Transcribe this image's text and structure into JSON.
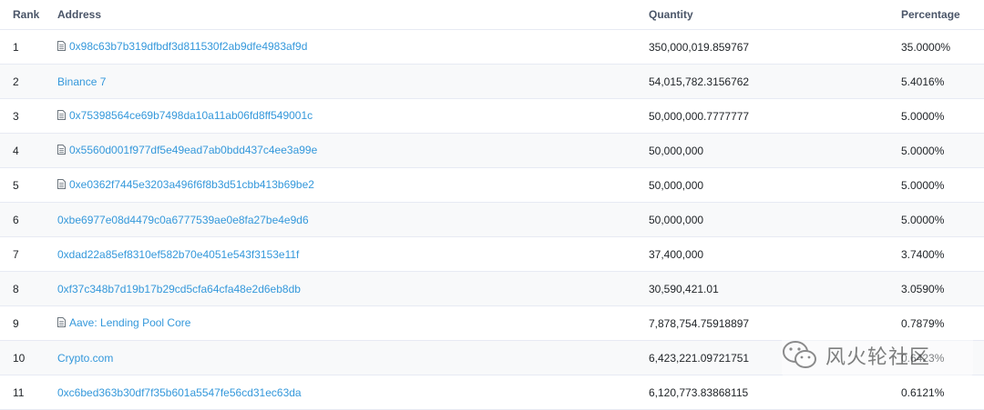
{
  "headers": {
    "rank": "Rank",
    "address": "Address",
    "quantity": "Quantity",
    "percentage": "Percentage"
  },
  "rows": [
    {
      "rank": "1",
      "address": "0x98c63b7b319dfbdf3d811530f2ab9dfe4983af9d",
      "contract": true,
      "quantity": "350,000,019.859767",
      "percentage": "35.0000%"
    },
    {
      "rank": "2",
      "address": "Binance 7",
      "contract": false,
      "quantity": "54,015,782.3156762",
      "percentage": "5.4016%"
    },
    {
      "rank": "3",
      "address": "0x75398564ce69b7498da10a11ab06fd8ff549001c",
      "contract": true,
      "quantity": "50,000,000.7777777",
      "percentage": "5.0000%"
    },
    {
      "rank": "4",
      "address": "0x5560d001f977df5e49ead7ab0bdd437c4ee3a99e",
      "contract": true,
      "quantity": "50,000,000",
      "percentage": "5.0000%"
    },
    {
      "rank": "5",
      "address": "0xe0362f7445e3203a496f6f8b3d51cbb413b69be2",
      "contract": true,
      "quantity": "50,000,000",
      "percentage": "5.0000%"
    },
    {
      "rank": "6",
      "address": "0xbe6977e08d4479c0a6777539ae0e8fa27be4e9d6",
      "contract": false,
      "quantity": "50,000,000",
      "percentage": "5.0000%"
    },
    {
      "rank": "7",
      "address": "0xdad22a85ef8310ef582b70e4051e543f3153e11f",
      "contract": false,
      "quantity": "37,400,000",
      "percentage": "3.7400%"
    },
    {
      "rank": "8",
      "address": "0xf37c348b7d19b17b29cd5cfa64cfa48e2d6eb8db",
      "contract": false,
      "quantity": "30,590,421.01",
      "percentage": "3.0590%"
    },
    {
      "rank": "9",
      "address": "Aave: Lending Pool Core",
      "contract": true,
      "quantity": "7,878,754.75918897",
      "percentage": "0.7879%"
    },
    {
      "rank": "10",
      "address": "Crypto.com",
      "contract": false,
      "quantity": "6,423,221.09721751",
      "percentage": "0.6423%"
    },
    {
      "rank": "11",
      "address": "0xc6bed363b30df7f35b601a5547fe56cd31ec63da",
      "contract": false,
      "quantity": "6,120,773.83868115",
      "percentage": "0.6121%"
    }
  ],
  "watermark": {
    "text": "风火轮社区",
    "icon": "wechat-icon"
  },
  "colors": {
    "link": "#3498db",
    "text": "#212529",
    "header": "#4a5568",
    "border": "#e7eaf3",
    "stripe": "#f8f9fa"
  },
  "icons": {
    "contract": "document-icon"
  }
}
